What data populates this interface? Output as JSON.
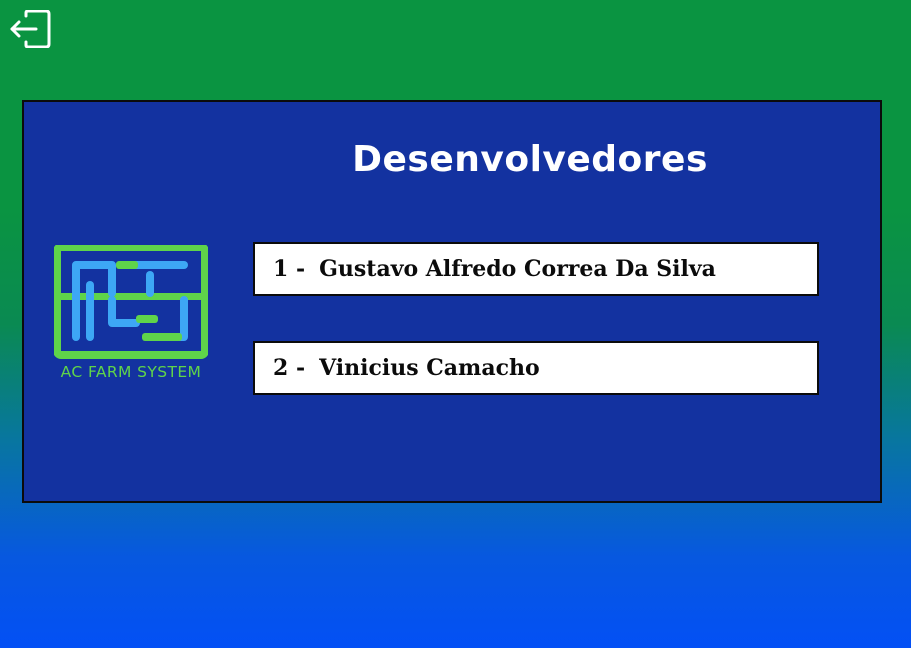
{
  "header": {
    "logout_icon": "logout-arrow-icon"
  },
  "panel": {
    "title": "Desenvolvedores"
  },
  "logo": {
    "icon": "ac-farm-system-logo-icon",
    "text": "AC FARM SYSTEM",
    "colors": {
      "green": "#5fd44a",
      "blue": "#3da7f5"
    }
  },
  "developers": [
    {
      "number": "1 -",
      "name": "Gustavo Alfredo Correa Da Silva"
    },
    {
      "number": "2 -",
      "name": "Vinicius Camacho"
    }
  ],
  "colors": {
    "panel_background": "#1332a0",
    "page_gradient_top": "#0a9441",
    "page_gradient_bottom": "#0350f5"
  }
}
